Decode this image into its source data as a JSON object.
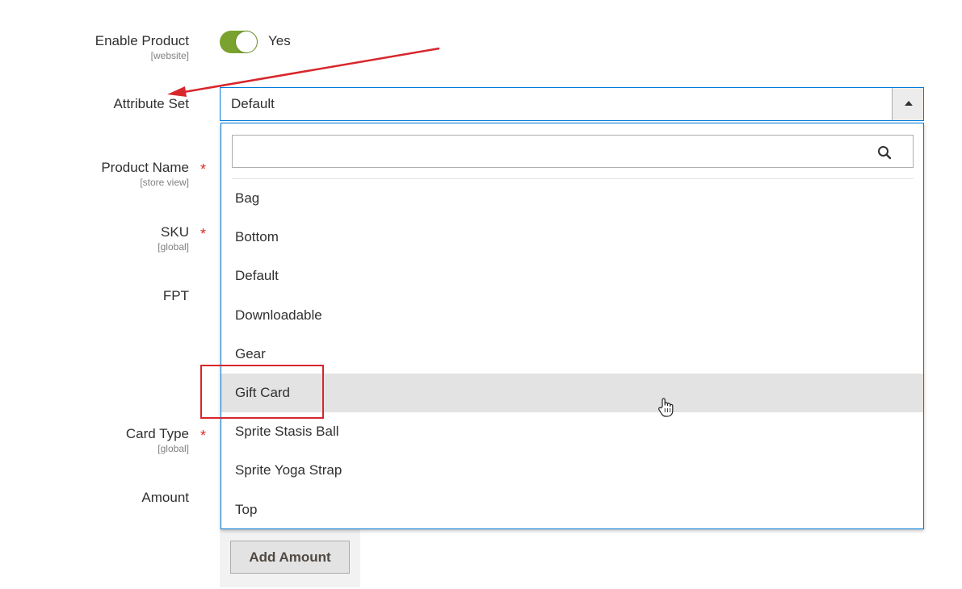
{
  "fields": {
    "enable_product": {
      "label": "Enable Product",
      "scope": "[website]",
      "value": "Yes"
    },
    "attribute_set": {
      "label": "Attribute Set",
      "value": "Default"
    },
    "product_name": {
      "label": "Product Name",
      "scope": "[store view]",
      "required": "*"
    },
    "sku": {
      "label": "SKU",
      "scope": "[global]",
      "required": "*"
    },
    "fpt": {
      "label": "FPT"
    },
    "card_type": {
      "label": "Card Type",
      "scope": "[global]",
      "required": "*"
    },
    "amount": {
      "label": "Amount"
    }
  },
  "dropdown": {
    "search_placeholder": "",
    "options": [
      "Bag",
      "Bottom",
      "Default",
      "Downloadable",
      "Gear",
      "Gift Card",
      "Sprite Stasis Ball",
      "Sprite Yoga Strap",
      "Top"
    ],
    "hovered_option": "Gift Card"
  },
  "buttons": {
    "add_amount": "Add Amount"
  },
  "icons": {
    "toggle": "toggle-switch-icon",
    "select_action": "caret-up-icon",
    "search": "search-icon",
    "cursor": "hand-cursor-icon"
  },
  "colors": {
    "toggle_on": "#79a22e",
    "focus_border": "#007bdb",
    "required": "#e02b27",
    "annotation": "#d8262b",
    "hover_row": "#e3e3e3"
  }
}
